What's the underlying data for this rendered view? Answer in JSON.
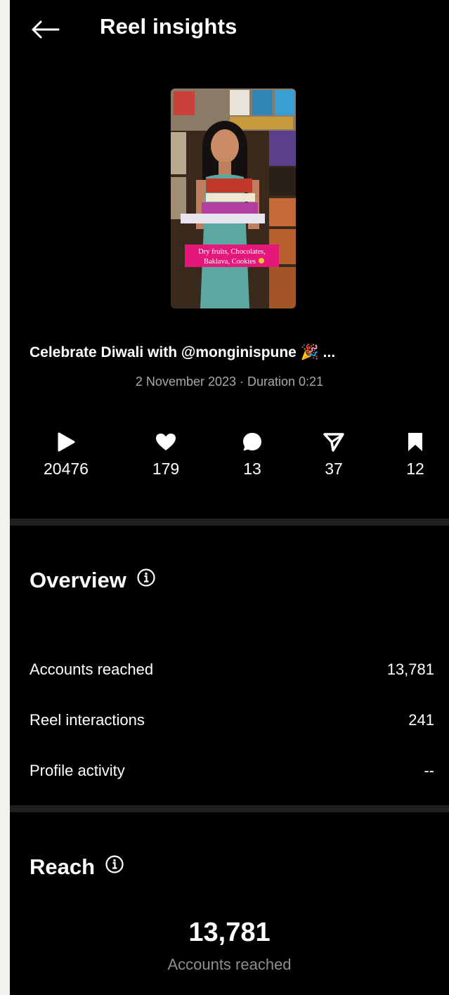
{
  "header": {
    "title": "Reel insights",
    "back_icon": "arrow-left-icon"
  },
  "reel": {
    "thumbnail_overlay_text_line1": "Dry fruits, Chocolates,",
    "thumbnail_overlay_text_line2": "Baklava, Cookies",
    "caption": "Celebrate Diwali with @monginispune 🎉 ...",
    "meta": "2 November 2023 · Duration 0:21"
  },
  "stats": [
    {
      "icon": "play-icon",
      "value": "20476"
    },
    {
      "icon": "heart-icon",
      "value": "179"
    },
    {
      "icon": "comment-icon",
      "value": "13"
    },
    {
      "icon": "share-icon",
      "value": "37"
    },
    {
      "icon": "bookmark-icon",
      "value": "12"
    }
  ],
  "overview": {
    "title": "Overview",
    "rows": [
      {
        "label": "Accounts reached",
        "value": "13,781"
      },
      {
        "label": "Reel interactions",
        "value": "241"
      },
      {
        "label": "Profile activity",
        "value": "--"
      }
    ]
  },
  "reach": {
    "title": "Reach",
    "value": "13,781",
    "label": "Accounts reached"
  },
  "colors": {
    "background": "#000000",
    "text": "#ffffff",
    "muted": "#a8a8a8",
    "divider": "#1f1f1f",
    "overlay_pink": "#e6177a"
  }
}
